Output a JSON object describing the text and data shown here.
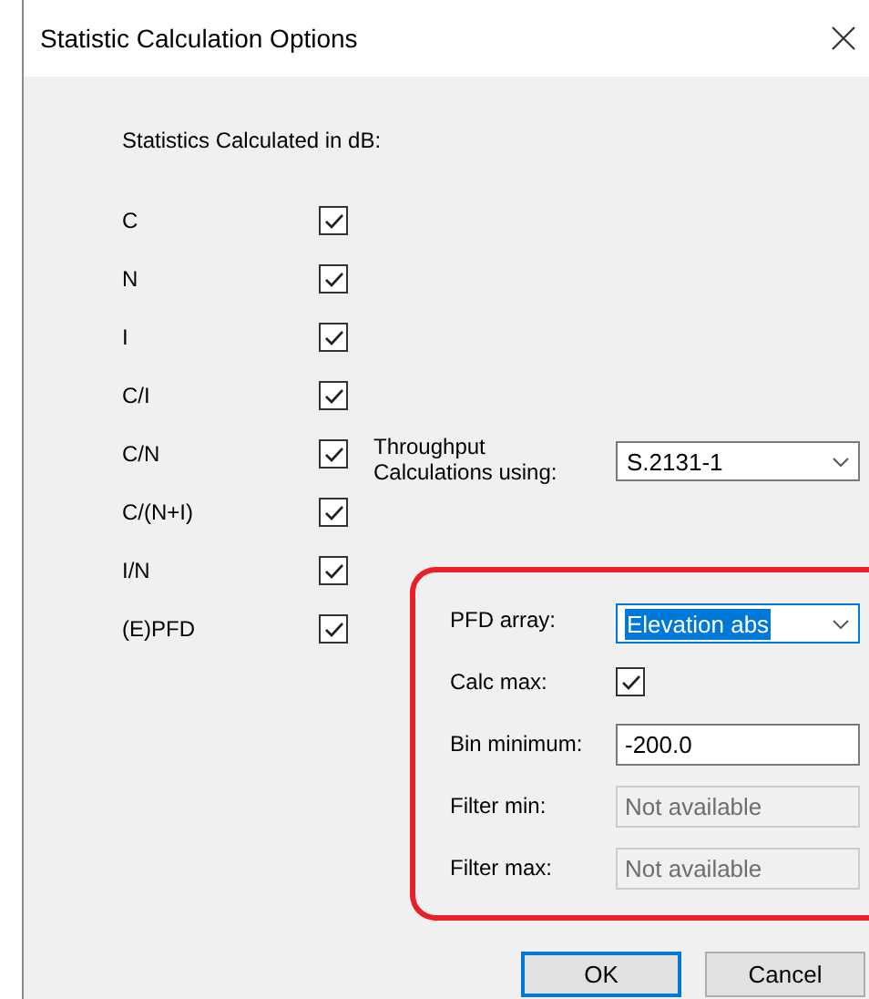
{
  "window": {
    "title": "Statistic Calculation Options"
  },
  "statistics": {
    "heading": "Statistics Calculated in dB:",
    "items": [
      {
        "label": "C",
        "checked": true
      },
      {
        "label": "N",
        "checked": true
      },
      {
        "label": "I",
        "checked": true
      },
      {
        "label": "C/I",
        "checked": true
      },
      {
        "label": "C/N",
        "checked": true
      },
      {
        "label": "C/(N+I)",
        "checked": true
      },
      {
        "label": "I/N",
        "checked": true
      },
      {
        "label": "(E)PFD",
        "checked": true
      }
    ]
  },
  "throughput": {
    "label": "Throughput Calculations using:",
    "value": "S.2131-1"
  },
  "pfd_group": {
    "rows": [
      {
        "kind": "dropdown",
        "label": "PFD array:",
        "value": "Elevation abs",
        "focused": true
      },
      {
        "kind": "checkbox",
        "label": "Calc max:",
        "checked": true
      },
      {
        "kind": "text",
        "label": "Bin minimum:",
        "value": "-200.0",
        "disabled": false
      },
      {
        "kind": "text",
        "label": "Filter min:",
        "value": "Not available",
        "disabled": true
      },
      {
        "kind": "text",
        "label": "Filter max:",
        "value": "Not available",
        "disabled": true
      }
    ]
  },
  "buttons": [
    {
      "label": "OK",
      "default": true
    },
    {
      "label": "Cancel",
      "default": false
    }
  ]
}
